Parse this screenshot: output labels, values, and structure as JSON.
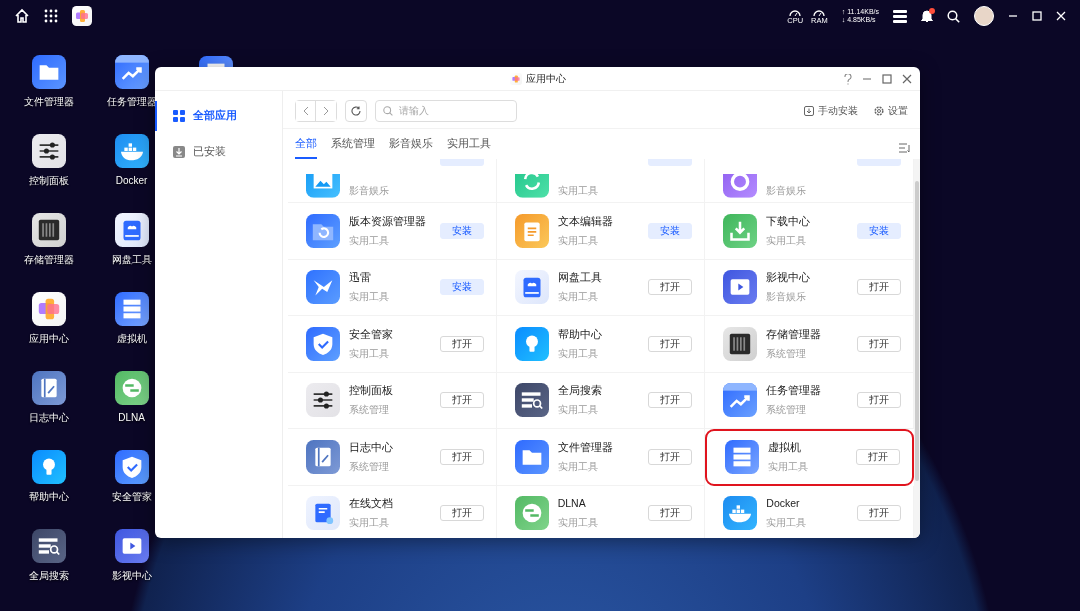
{
  "top_bar": {
    "cpu_label": "CPU",
    "ram_label": "RAM",
    "network_up": "↑ 11.14KB/s",
    "network_down": "↓ 4.85KB/s",
    "notification": true
  },
  "desktop_icons": [
    {
      "label": "文件管理器",
      "kind": "folder"
    },
    {
      "label": "任务管理器",
      "kind": "chart"
    },
    {
      "label": "控制面板",
      "kind": "sliders"
    },
    {
      "label": "Docker",
      "kind": "docker"
    },
    {
      "label": "存储管理器",
      "kind": "storage"
    },
    {
      "label": "网盘工具",
      "kind": "disk"
    },
    {
      "label": "应用中心",
      "kind": "appcenter"
    },
    {
      "label": "虚拟机",
      "kind": "server"
    },
    {
      "label": "日志中心",
      "kind": "journal"
    },
    {
      "label": "DLNA",
      "kind": "dlna"
    },
    {
      "label": "帮助中心",
      "kind": "bulb"
    },
    {
      "label": "安全管家",
      "kind": "shield"
    },
    {
      "label": "全局搜索",
      "kind": "searchlist"
    },
    {
      "label": "影视中心",
      "kind": "video"
    }
  ],
  "window": {
    "title": "应用中心",
    "sidebar": [
      {
        "label": "全部应用",
        "kind": "grid",
        "selected": true
      },
      {
        "label": "已安装",
        "kind": "installed",
        "selected": false
      }
    ],
    "search": {
      "placeholder": "请输入"
    },
    "actions": [
      {
        "label": "手动安装",
        "kind": "install"
      },
      {
        "label": "设置",
        "kind": "gear"
      }
    ],
    "tabs": [
      {
        "label": "全部",
        "selected": true
      },
      {
        "label": "系统管理",
        "selected": false
      },
      {
        "label": "影音娱乐",
        "selected": false
      },
      {
        "label": "实用工具",
        "selected": false
      }
    ],
    "partial_apps": [
      {
        "category": "影音娱乐",
        "kind": "photo",
        "installed": false
      },
      {
        "category": "实用工具",
        "kind": "sync",
        "installed": false
      },
      {
        "category": "影音娱乐",
        "kind": "music",
        "installed": false
      }
    ],
    "apps": [
      {
        "name": "版本资源管理器",
        "category": "实用工具",
        "kind": "restore",
        "installed": false,
        "action": "安装",
        "highlighted": false
      },
      {
        "name": "文本编辑器",
        "category": "实用工具",
        "kind": "notepad",
        "installed": false,
        "action": "安装",
        "highlighted": false
      },
      {
        "name": "下载中心",
        "category": "实用工具",
        "kind": "download",
        "installed": false,
        "action": "安装",
        "highlighted": false
      },
      {
        "name": "迅雷",
        "category": "实用工具",
        "kind": "bird",
        "installed": false,
        "action": "安装",
        "highlighted": false
      },
      {
        "name": "网盘工具",
        "category": "实用工具",
        "kind": "disk",
        "installed": true,
        "action": "打开",
        "highlighted": false
      },
      {
        "name": "影视中心",
        "category": "影音娱乐",
        "kind": "video",
        "installed": true,
        "action": "打开",
        "highlighted": false
      },
      {
        "name": "安全管家",
        "category": "实用工具",
        "kind": "shield",
        "installed": true,
        "action": "打开",
        "highlighted": false
      },
      {
        "name": "帮助中心",
        "category": "实用工具",
        "kind": "bulb",
        "installed": true,
        "action": "打开",
        "highlighted": false
      },
      {
        "name": "存储管理器",
        "category": "系统管理",
        "kind": "storage",
        "installed": true,
        "action": "打开",
        "highlighted": false
      },
      {
        "name": "控制面板",
        "category": "系统管理",
        "kind": "sliders",
        "installed": true,
        "action": "打开",
        "highlighted": false
      },
      {
        "name": "全局搜索",
        "category": "实用工具",
        "kind": "searchlist",
        "installed": true,
        "action": "打开",
        "highlighted": false
      },
      {
        "name": "任务管理器",
        "category": "系统管理",
        "kind": "chart",
        "installed": true,
        "action": "打开",
        "highlighted": false
      },
      {
        "name": "日志中心",
        "category": "系统管理",
        "kind": "journal",
        "installed": true,
        "action": "打开",
        "highlighted": false
      },
      {
        "name": "文件管理器",
        "category": "实用工具",
        "kind": "folder",
        "installed": true,
        "action": "打开",
        "highlighted": false
      },
      {
        "name": "虚拟机",
        "category": "实用工具",
        "kind": "server",
        "installed": true,
        "action": "打开",
        "highlighted": true
      },
      {
        "name": "在线文档",
        "category": "实用工具",
        "kind": "doc",
        "installed": true,
        "action": "打开",
        "highlighted": false
      },
      {
        "name": "DLNA",
        "category": "实用工具",
        "kind": "dlna",
        "installed": true,
        "action": "打开",
        "highlighted": false
      },
      {
        "name": "Docker",
        "category": "实用工具",
        "kind": "docker",
        "installed": true,
        "action": "打开",
        "highlighted": false
      }
    ]
  }
}
